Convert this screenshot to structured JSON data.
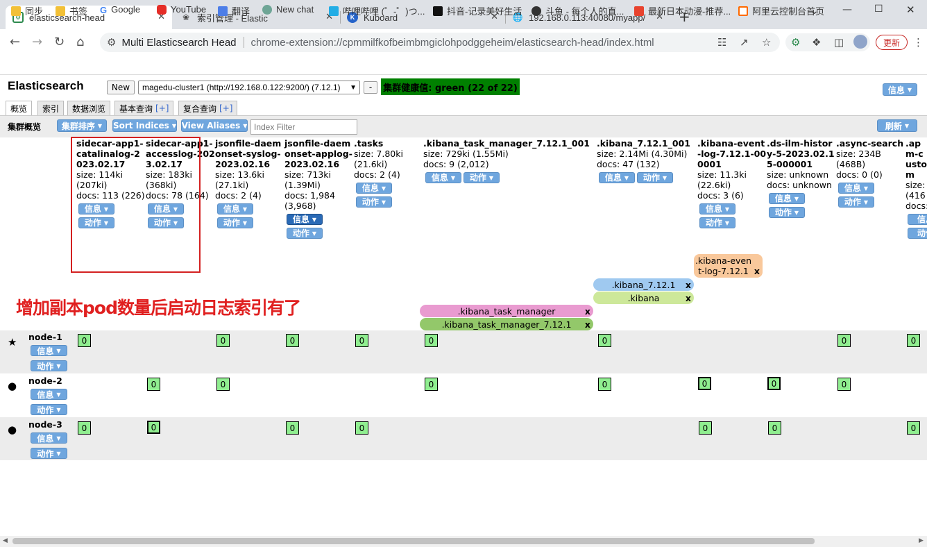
{
  "browser": {
    "tabs": [
      {
        "title": "elasticsearch-head",
        "icon": "puzzle-icon",
        "active": true
      },
      {
        "title": "索引管理 - Elastic",
        "icon": "elastic-icon",
        "active": false
      },
      {
        "title": "Kuboard",
        "icon": "kuboard-icon",
        "active": false
      },
      {
        "title": "192.168.0.113:40080/myapp/",
        "icon": "globe-icon",
        "active": false
      }
    ],
    "new_tab": "+",
    "omnibox": {
      "site": "Multi Elasticsearch Head",
      "url": "chrome-extension://cpmmilfkofbeimbmgiclohpodggeheim/elasticsearch-head/index.html"
    },
    "update_label": "更新",
    "bookmarks": [
      "同步",
      "书签",
      "Google",
      "YouTube",
      "翻译",
      "New chat",
      "哔哩哔哩 (゜-゜)つ...",
      "抖音-记录美好生活",
      "斗鱼 - 每个人的直...",
      "最新日本动漫-推荐...",
      "阿里云控制台首页"
    ]
  },
  "app": {
    "title": "Elasticsearch",
    "new_button": "New",
    "cluster_select": "magedu-cluster1 (http://192.168.0.122:9200/) (7.12.1)",
    "minus_button": "-",
    "health": "集群健康值: green (22 of 22)",
    "info_button": "信息",
    "tabs": [
      {
        "label": "概览"
      },
      {
        "label": "索引"
      },
      {
        "label": "数据浏览"
      },
      {
        "label": "基本查询",
        "plus": "[+]"
      },
      {
        "label": "复合查询",
        "plus": "[+]"
      }
    ],
    "subbar": {
      "label": "集群概览",
      "sort_cluster": "集群排序",
      "sort_indices": "Sort Indices",
      "view_aliases": "View Aliases",
      "filter_placeholder": "Index Filter",
      "refresh": "刷新"
    },
    "btn_info": "信息",
    "btn_action": "动作"
  },
  "indices": [
    {
      "name": "sidecar-app1-catalinalog-2023.02.17",
      "size": "size: 114ki (207ki)",
      "docs": "docs: 113 (226)"
    },
    {
      "name": "sidecar-app1-accesslog-2023.02.17",
      "size": "size: 183ki (368ki)",
      "docs": "docs: 78 (164)"
    },
    {
      "name": "jsonfile-daemonset-syslog-2023.02.16",
      "size": "size: 13.6ki (27.1ki)",
      "docs": "docs: 2 (4)"
    },
    {
      "name": "jsonfile-daemonset-applog-2023.02.16",
      "size": "size: 713ki (1.39Mi)",
      "docs": "docs: 1,984 (3,968)"
    },
    {
      "name": ".tasks",
      "size": "size: 7.80ki (21.6ki)",
      "docs": "docs: 2 (4)"
    },
    {
      "name": ".kibana_task_manager_7.12.1_001",
      "size": "size: 729ki (1.55Mi)",
      "docs": "docs: 9 (2,012)"
    },
    {
      "name": ".kibana_7.12.1_001",
      "size": "size: 2.14Mi (4.30Mi)",
      "docs": "docs: 47 (132)"
    },
    {
      "name": ".kibana-event-log-7.12.1-000001",
      "size": "size: 11.3ki (22.6ki)",
      "docs": "docs: 3 (6)"
    },
    {
      "name": ".ds-ilm-history-5-2023.02.15-000001",
      "size": "size: unknown",
      "docs": "docs: unknown"
    },
    {
      "name": ".async-search",
      "size": "size: 234B (468B)",
      "docs": "docs: 0 (0)"
    },
    {
      "name": ".apm-custom",
      "size": "size: (416",
      "docs": "docs:"
    }
  ],
  "aliases": [
    {
      "name": ".kibana-event-log-7.12.1",
      "color": "#f9c89b"
    },
    {
      "name": ".kibana_7.12.1",
      "color": "#9fc9f0"
    },
    {
      "name": ".kibana",
      "color": "#cde89a"
    },
    {
      "name": ".kibana_task_manager",
      "color": "#e99bd0"
    },
    {
      "name": ".kibana_task_manager_7.12.1",
      "color": "#93c86a"
    }
  ],
  "alias_close": "x",
  "nodes": [
    {
      "name": "node-1",
      "marker": "★"
    },
    {
      "name": "node-2",
      "marker": "●"
    },
    {
      "name": "node-3",
      "marker": "●"
    }
  ],
  "shard_label": "0",
  "annotation": "增加副本pod数量后启动日志索引有了"
}
